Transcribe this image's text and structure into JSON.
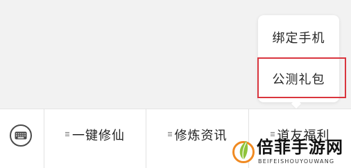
{
  "popup_menu": {
    "items": [
      {
        "label": "绑定手机"
      },
      {
        "label": "公测礼包"
      }
    ],
    "highlight_color": "#d9343d"
  },
  "bottom_bar": {
    "keyboard_toggle_icon": "keyboard-icon",
    "tabs": [
      {
        "label": "一键修仙",
        "icon": "menu-icon"
      },
      {
        "label": "修炼资讯",
        "icon": "menu-icon"
      },
      {
        "label": "道友福利",
        "icon": "menu-icon"
      }
    ]
  },
  "watermark": {
    "logo_text": "倍菲手游网",
    "sub_text": "BEIFEISHOUYOUWANG"
  }
}
